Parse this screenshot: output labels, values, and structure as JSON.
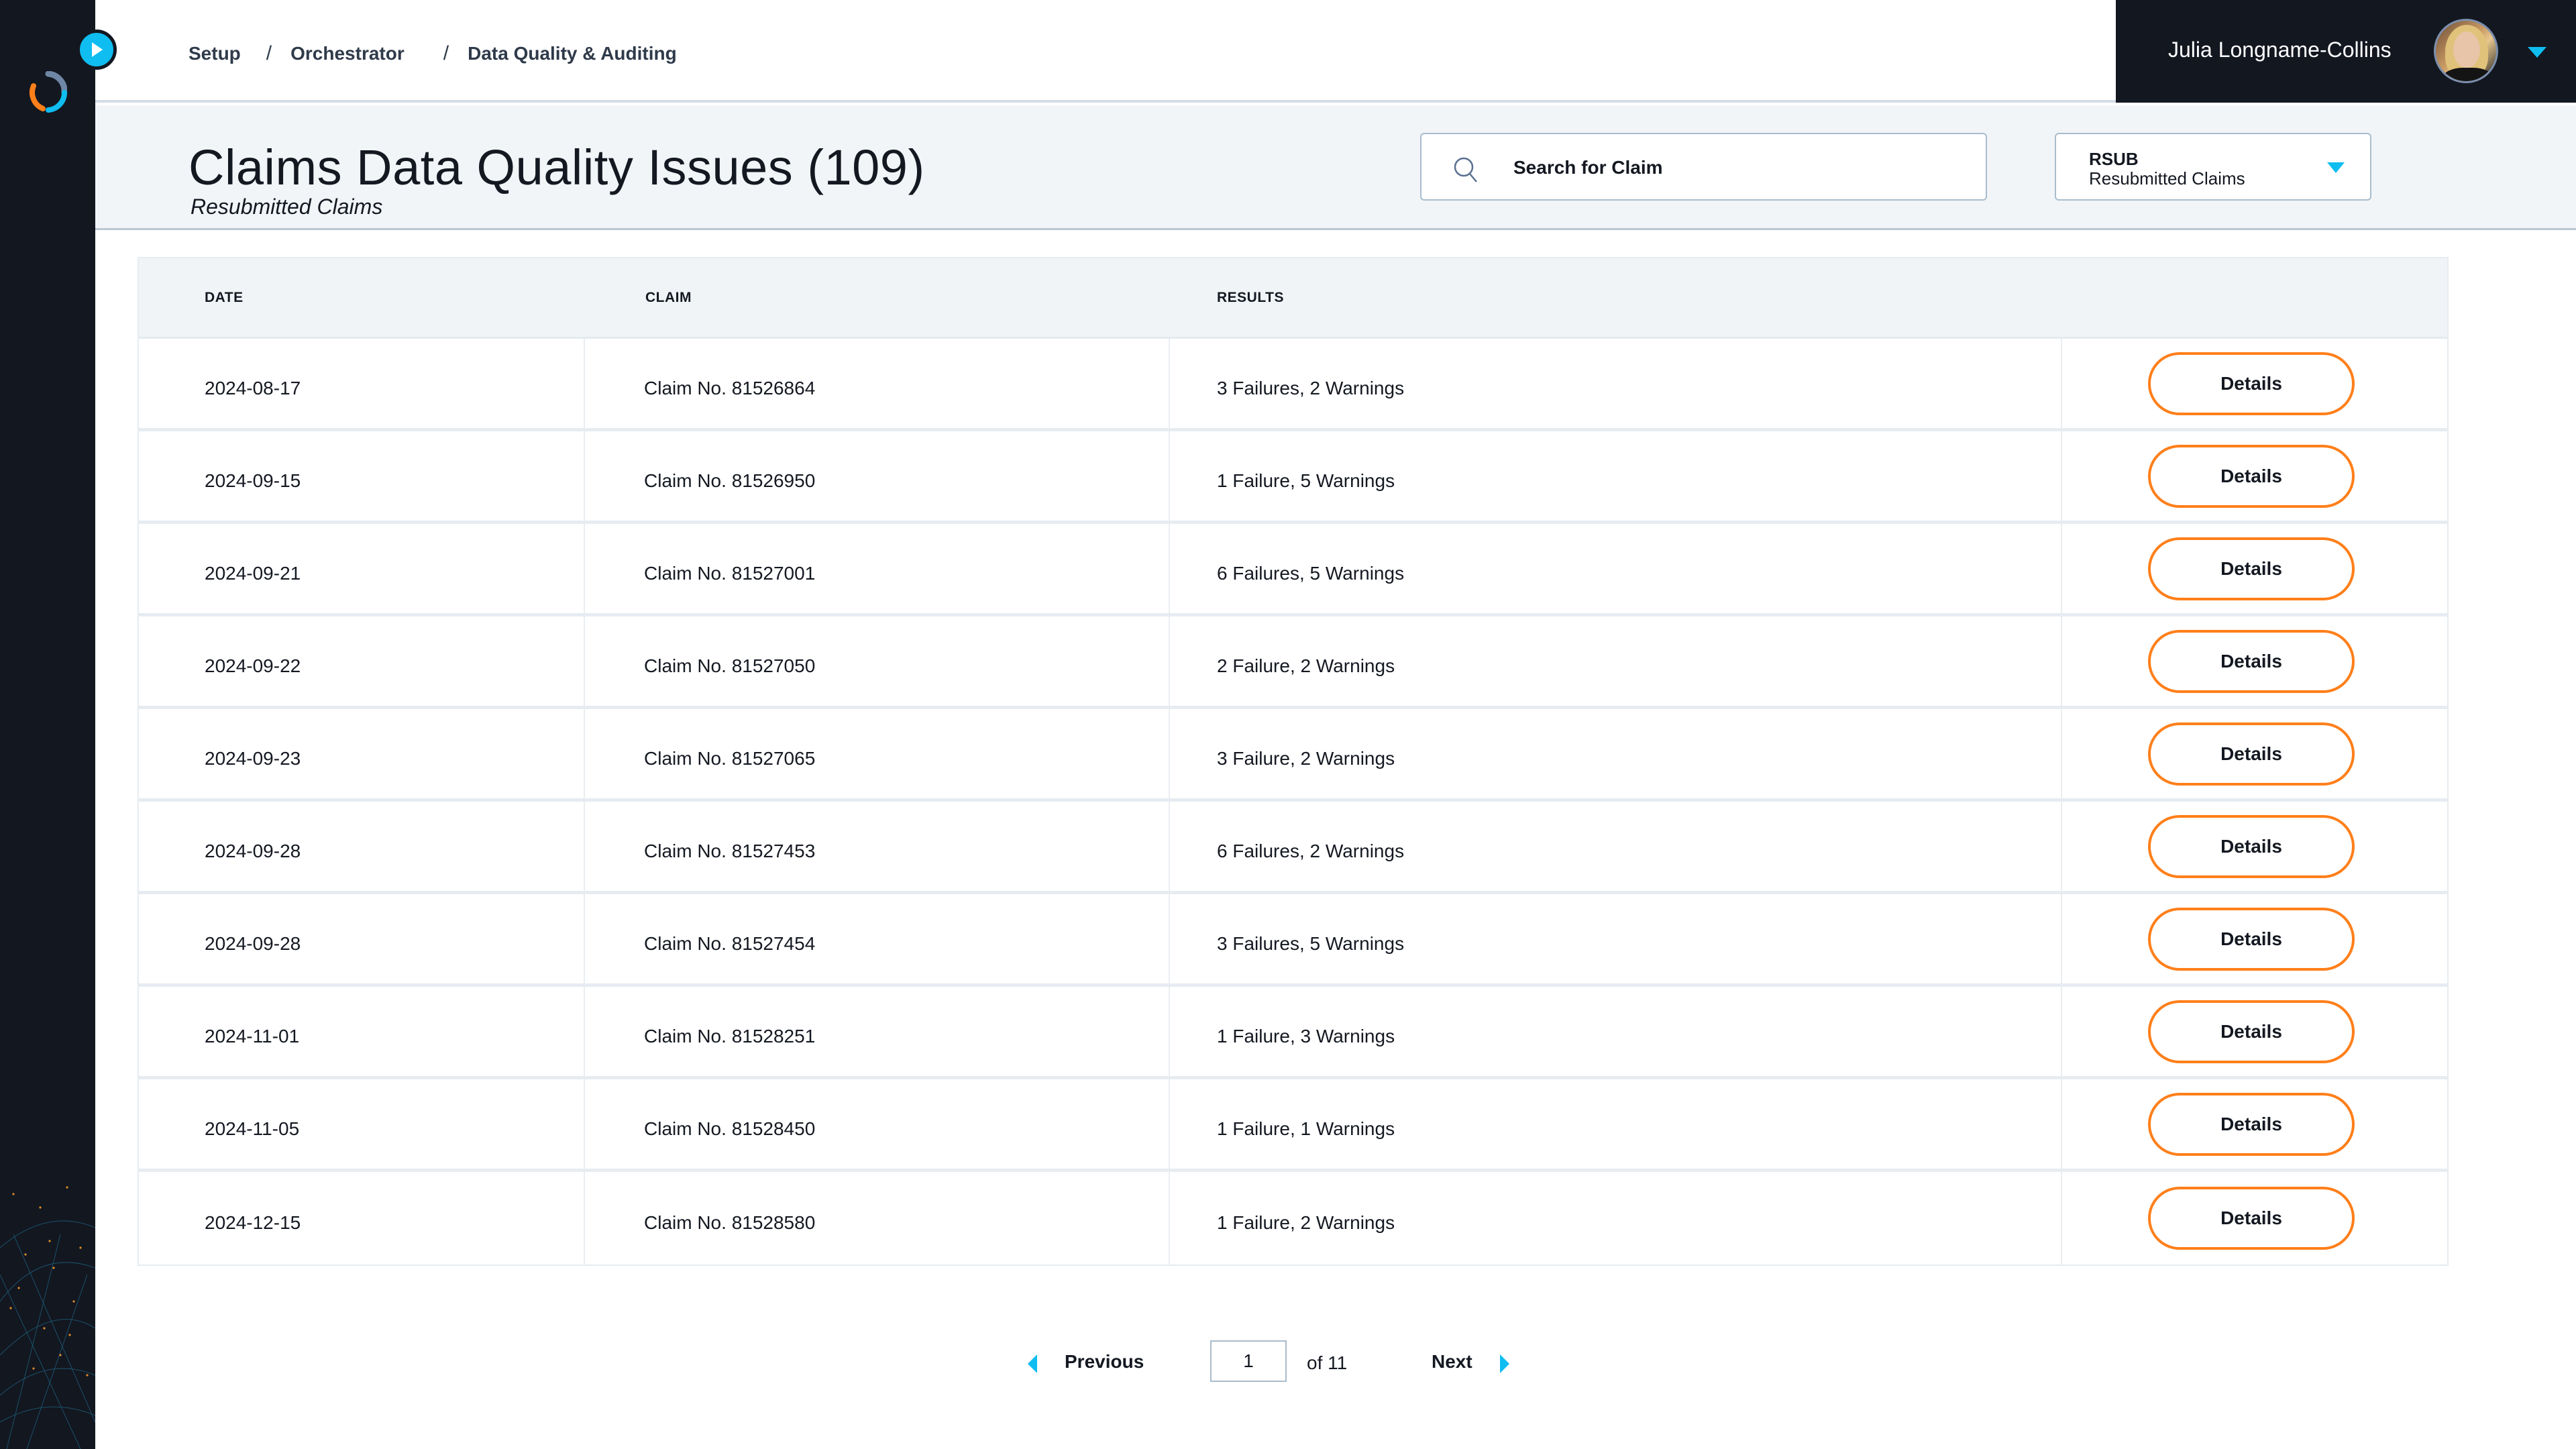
{
  "colors": {
    "accent": "#0fbdf0",
    "button_border": "#ff7f1a",
    "dark": "#131720",
    "band": "#f2f5f8"
  },
  "icons": {
    "logo": "ring-logo-icon",
    "expand": "play-triangle-icon",
    "search": "magnifier-icon",
    "dropdown": "triangle-down-icon",
    "prev": "triangle-left-icon",
    "next": "triangle-right-icon"
  },
  "breadcrumb": {
    "items": [
      "Setup",
      "Orchestrator",
      "Data Quality & Auditing"
    ],
    "separator": "/"
  },
  "user": {
    "name": "Julia Longname-Collins"
  },
  "page": {
    "title": "Claims Data Quality Issues (109)",
    "subtitle": "Resubmitted Claims"
  },
  "search": {
    "placeholder": "Search for Claim",
    "value": ""
  },
  "filter": {
    "code": "RSUB",
    "label": "Resubmitted Claims"
  },
  "table": {
    "columns": [
      "DATE",
      "CLAIM",
      "RESULTS",
      ""
    ],
    "action_label": "Details",
    "rows": [
      {
        "date": "2024-08-17",
        "claim": "Claim No. 81526864",
        "results": "3 Failures, 2 Warnings"
      },
      {
        "date": "2024-09-15",
        "claim": "Claim No. 81526950",
        "results": "1 Failure, 5 Warnings"
      },
      {
        "date": "2024-09-21",
        "claim": "Claim No. 81527001",
        "results": "6 Failures, 5 Warnings"
      },
      {
        "date": "2024-09-22",
        "claim": "Claim No. 81527050",
        "results": "2 Failure, 2 Warnings"
      },
      {
        "date": "2024-09-23",
        "claim": "Claim No. 81527065",
        "results": "3 Failure, 2 Warnings"
      },
      {
        "date": "2024-09-28",
        "claim": "Claim No. 81527453",
        "results": "6 Failures, 2 Warnings"
      },
      {
        "date": "2024-09-28",
        "claim": "Claim No. 81527454",
        "results": "3 Failures, 5 Warnings"
      },
      {
        "date": "2024-11-01",
        "claim": "Claim No. 81528251",
        "results": "1 Failure, 3 Warnings"
      },
      {
        "date": "2024-11-05",
        "claim": "Claim No. 81528450",
        "results": "1 Failure, 1 Warnings"
      },
      {
        "date": "2024-12-15",
        "claim": "Claim No. 81528580",
        "results": "1 Failure, 2 Warnings"
      }
    ]
  },
  "pagination": {
    "previous_label": "Previous",
    "next_label": "Next",
    "current_page": "1",
    "total_label": "of 11"
  }
}
